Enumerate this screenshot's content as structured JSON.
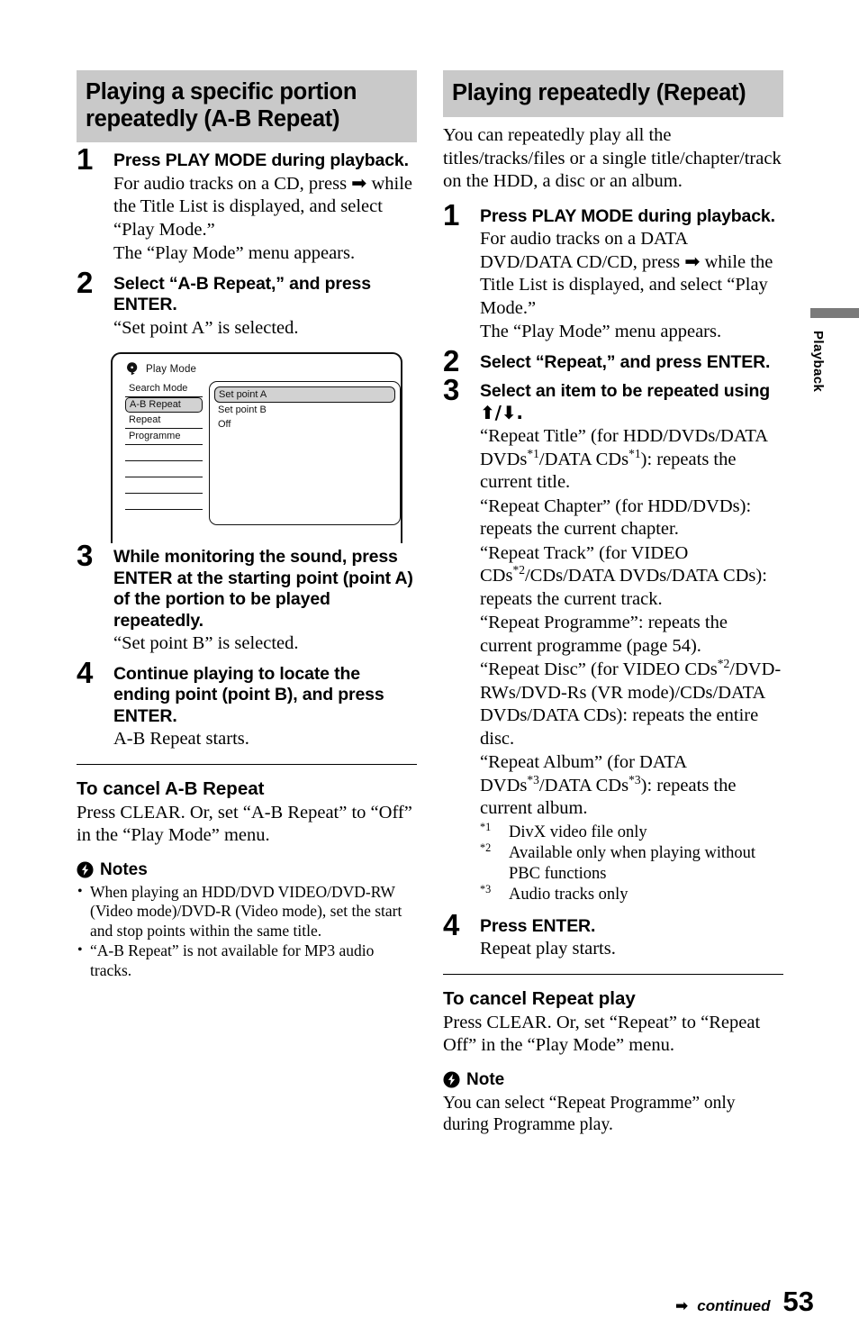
{
  "page_number": "53",
  "side_tab": {
    "label": "Playback"
  },
  "footer": {
    "continued_label": "continued",
    "arrow": "➡",
    "page_number": "53"
  },
  "left_column": {
    "section_title": "Playing a specific portion repeatedly (A-B Repeat)",
    "steps": [
      {
        "number": "1",
        "heading": "Press PLAY MODE during playback.",
        "sub_lines": [
          "For audio tracks on a CD, press ➡ while the Title List is displayed, and select “Play Mode.”",
          "The “Play Mode” menu appears."
        ]
      },
      {
        "number": "2",
        "heading": "Select “A-B Repeat,” and press ENTER.",
        "sub_lines": [
          "“Set point A” is selected."
        ]
      },
      {
        "number": "3",
        "heading": "While monitoring the sound, press ENTER at the starting point (point A) of the portion to be played repeatedly.",
        "sub_lines": [
          "“Set point B” is selected."
        ]
      },
      {
        "number": "4",
        "heading": "Continue playing to locate the ending point (point B), and press ENTER.",
        "sub_lines": [
          "A-B Repeat starts."
        ]
      }
    ],
    "osd": {
      "title": "Play Mode",
      "icon": "disc-icon",
      "menu_items": [
        "Search Mode",
        "A-B Repeat",
        "Repeat",
        "Programme",
        "",
        "",
        "",
        ""
      ],
      "menu_selected": "A-B Repeat",
      "options": [
        "Set point A",
        "Set point B",
        "Off"
      ],
      "option_selected": "Set point A"
    },
    "cancel": {
      "heading": "To cancel A-B Repeat",
      "body": "Press CLEAR. Or, set “A-B Repeat” to “Off” in the “Play Mode” menu."
    },
    "notes": {
      "heading": "Notes",
      "items": [
        "When playing an HDD/DVD VIDEO/DVD-RW (Video mode)/DVD-R (Video mode), set the start and stop points within the same title.",
        "“A-B Repeat” is not available for MP3 audio tracks."
      ]
    }
  },
  "right_column": {
    "section_title": "Playing repeatedly (Repeat)",
    "intro": "You can repeatedly play all the titles/tracks/files or a single title/chapter/track on the HDD, a disc or an album.",
    "steps": [
      {
        "number": "1",
        "heading": "Press PLAY MODE during playback.",
        "sub_lines": [
          "For audio tracks on a DATA DVD/DATA CD/CD, press ➡ while the Title List is displayed, and select “Play Mode.”",
          "The “Play Mode” menu appears."
        ]
      },
      {
        "number": "2",
        "heading": "Select “Repeat,” and press ENTER.",
        "sub_lines": []
      },
      {
        "number": "3",
        "heading_part1": "Select an item to be repeated using",
        "heading_arrows": "⬆/⬇.",
        "items": [
          {
            "name": "“Repeat Title”",
            "scope": "(for HDD/DVDs/DATA DVDs*1/DATA CDs*1)",
            "desc": ": repeats the current title."
          },
          {
            "name": "“Repeat Chapter”",
            "scope": "(for HDD/DVDs)",
            "desc": ": repeats the current chapter."
          },
          {
            "name": "“Repeat Track”",
            "scope": "(for VIDEO CDs*2/CDs/DATA DVDs/DATA CDs)",
            "desc": ": repeats the current track."
          },
          {
            "name": "“Repeat Programme”",
            "scope": "",
            "desc": ": repeats the current programme (page 54)."
          },
          {
            "name": "“Repeat Disc”",
            "scope": "(for VIDEO CDs*2/DVD-RWs/DVD-Rs (VR mode)/CDs/DATA DVDs/DATA CDs)",
            "desc": ": repeats the entire disc."
          },
          {
            "name": "“Repeat Album”",
            "scope": "(for DATA DVDs*3/DATA CDs*3)",
            "desc": ": repeats the current album."
          }
        ],
        "footnotes": [
          {
            "mark": "*1",
            "text": "DivX video file only"
          },
          {
            "mark": "*2",
            "text": "Available only when playing without PBC functions"
          },
          {
            "mark": "*3",
            "text": "Audio tracks only"
          }
        ]
      },
      {
        "number": "4",
        "heading": "Press ENTER.",
        "sub_lines": [
          "Repeat play starts."
        ]
      }
    ],
    "cancel": {
      "heading": "To cancel Repeat play",
      "body": "Press CLEAR. Or, set “Repeat” to “Repeat Off” in the “Play Mode” menu."
    },
    "note": {
      "heading": "Note",
      "body": "You can select “Repeat Programme” only during Programme play."
    }
  },
  "colors": {
    "header_band": "#c9c9c9",
    "osd_highlight": "#d2d2d2",
    "side_bar": "#7a7a7a"
  }
}
